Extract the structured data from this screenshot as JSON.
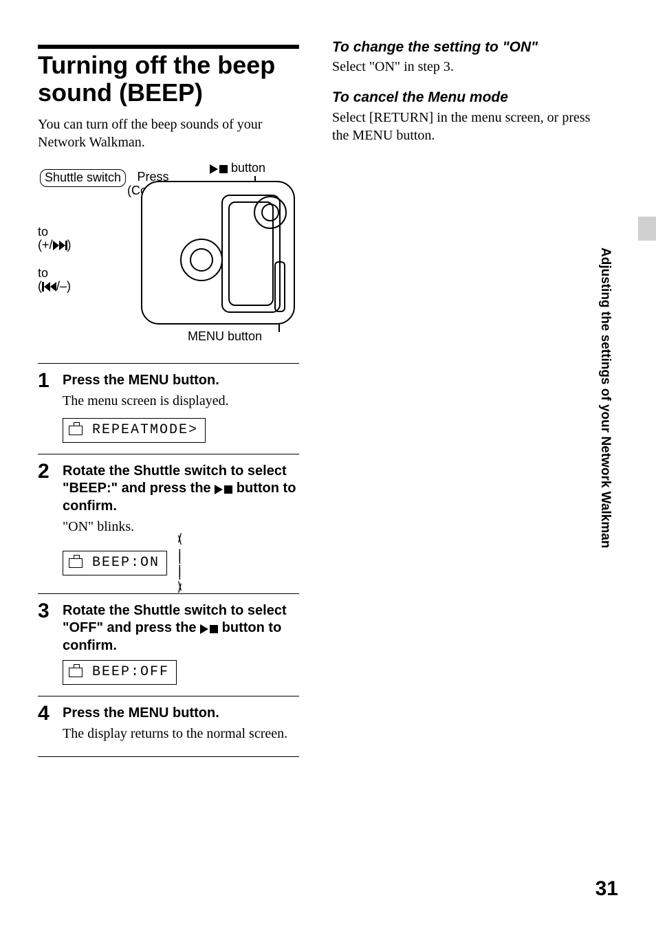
{
  "title": "Turning off the beep sound (BEEP)",
  "intro": "You can turn off the beep sounds of your Network Walkman.",
  "diagram": {
    "shuttle_label": "Shuttle switch",
    "press_label": "Press\n(Confirm)",
    "play_button_label": " button",
    "to_forward": "to\n(+/",
    "to_forward_end": ")",
    "to_back": "to\n(",
    "to_back_end": "/–)",
    "menu_label": "MENU button"
  },
  "steps": [
    {
      "num": "1",
      "head": "Press the MENU button.",
      "sub": "The menu screen is displayed.",
      "lcd": "REPEATMODE>"
    },
    {
      "num": "2",
      "head_a": "Rotate the Shuttle switch to select \"BEEP:\" and press the ",
      "head_b": " button to confirm.",
      "sub": "\"ON\" blinks.",
      "lcd": "BEEP:ON"
    },
    {
      "num": "3",
      "head_a": "Rotate the Shuttle switch to select \"OFF\" and press the ",
      "head_b": " button to confirm.",
      "lcd": "BEEP:OFF"
    },
    {
      "num": "4",
      "head": "Press the MENU button.",
      "sub": "The display returns to the normal screen."
    }
  ],
  "right": {
    "h1": "To change the setting to \"ON\"",
    "p1": "Select \"ON\" in step 3.",
    "h2": "To cancel the Menu mode",
    "p2": "Select [RETURN] in the menu screen, or press the MENU button."
  },
  "side_label": "Adjusting the settings of your Network Walkman",
  "page": "31"
}
